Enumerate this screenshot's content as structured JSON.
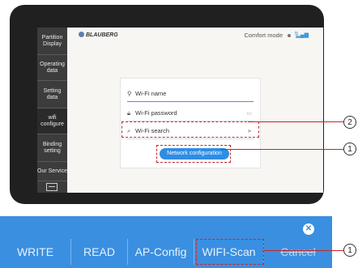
{
  "sidebar": {
    "items": [
      {
        "label": "Partition Display"
      },
      {
        "label": "Operating data"
      },
      {
        "label": "Setting data"
      },
      {
        "label": "wifi configure"
      },
      {
        "label": "Binding setting"
      },
      {
        "label": "Our Service"
      }
    ]
  },
  "header": {
    "brand": "BLAUBERG",
    "mode": "Comfort mode"
  },
  "form": {
    "wifi_name": "Wi-Fi name",
    "wifi_password": "Wi-Fi password",
    "wifi_search": "Wi-Fi search",
    "network_button": "Network configuration"
  },
  "callouts": {
    "c1": "1",
    "c2": "2",
    "c3": "1"
  },
  "toolbar": {
    "buttons": [
      "WRITE",
      "READ",
      "AP-Config",
      "WIFI-Scan",
      "Cancel"
    ]
  },
  "colors": {
    "accent": "#3a8fe0",
    "highlight": "#c62828",
    "sidebar": "#3c3c3c"
  },
  "icons": [
    "person-icon",
    "lock-icon",
    "search-icon",
    "close-icon",
    "exit-icon"
  ]
}
